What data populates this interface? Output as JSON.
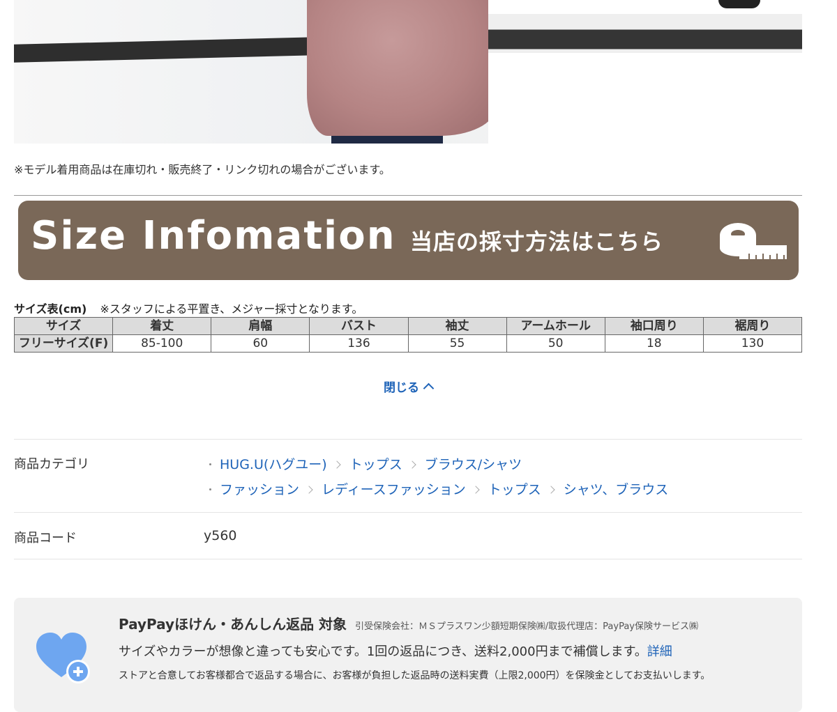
{
  "photo": {
    "description_icon": "product-model-photo"
  },
  "note": "※モデル着用商品は在庫切れ・販売終了・リンク切れの場合がございます。",
  "banner": {
    "title": "Size Infomation",
    "subtitle": "当店の採寸方法はこちら",
    "icon": "measuring-tape-icon",
    "bg_color": "#7a6858"
  },
  "size_table": {
    "caption_bold": "サイズ表(cm)",
    "caption_note": "※スタッフによる平置き、メジャー採寸となります。",
    "headers": [
      "サイズ",
      "着丈",
      "肩幅",
      "バスト",
      "袖丈",
      "アームホール",
      "袖口周り",
      "裾周り"
    ],
    "rows": [
      [
        "フリーサイズ(F)",
        "85-100",
        "60",
        "136",
        "55",
        "50",
        "18",
        "130"
      ]
    ]
  },
  "toggle": {
    "close_label": "閉じる"
  },
  "category": {
    "label": "商品カテゴリ",
    "paths": [
      [
        "HUG.U(ハグユー)",
        "トップス",
        "ブラウス/シャツ"
      ],
      [
        "ファッション",
        "レディースファッション",
        "トップス",
        "シャツ、ブラウス"
      ]
    ]
  },
  "product_code": {
    "label": "商品コード",
    "value": "y560"
  },
  "paypay": {
    "title": "PayPayほけん・あんしん返品 対象",
    "insurer": "引受保険会社：ＭＳプラスワン少額短期保険㈱/取扱代理店：PayPay保険サービス㈱",
    "line": "サイズやカラーが想像と違っても安心です。1回の返品につき、送料2,000円まで補償します。",
    "detail_link": "詳細",
    "small": "ストアと合意してお客様都合で返品する場合に、お客様が負担した返品時の送料実費（上限2,000円）を保険金としてお支払いします。",
    "icon": "heart-plus-icon",
    "icon_color": "#6ea6f0"
  },
  "colors": {
    "link": "#1e63b8",
    "text": "#333333"
  }
}
